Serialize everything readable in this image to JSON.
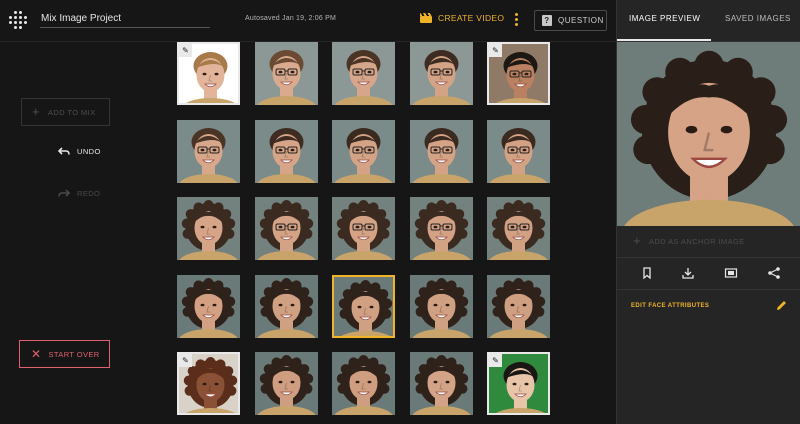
{
  "header": {
    "project_title": "Mix Image Project",
    "autosave": "Autosaved Jan 19, 2:06 PM",
    "create_video": "CREATE VIDEO",
    "question": "QUESTION"
  },
  "left": {
    "add_to_mix": "ADD TO MIX",
    "undo": "UNDO",
    "redo": "REDO",
    "start_over": "START OVER"
  },
  "right_panel": {
    "tab_preview": "IMAGE PREVIEW",
    "tab_saved": "SAVED IMAGES",
    "add_anchor": "ADD AS ANCHOR IMAGE",
    "edit_face_attributes": "EDIT FACE ATTRIBUTES"
  },
  "colors": {
    "accent": "#f0b429",
    "danger": "#e0626e",
    "background": "#161616",
    "panel": "#252525"
  },
  "icons": {
    "logo": "dotted-grid-logo",
    "create_video": "clapperboard-icon",
    "more": "kebab-menu-icon",
    "question": "question-mark-icon",
    "undo": "undo-arrow-icon",
    "redo": "redo-arrow-icon",
    "start_over": "close-x-icon",
    "bookmark": "bookmark-icon",
    "download": "download-icon",
    "slideshow": "slideshow-icon",
    "share": "share-icon",
    "edit": "pencil-icon"
  },
  "grid": {
    "rows": 5,
    "columns": 5,
    "anchors": [
      0,
      4,
      20,
      24
    ],
    "selected": 17,
    "tiles": [
      {
        "skin": "#e2b59a",
        "hair": "#a87a4a",
        "bg": "#ffffff",
        "glasses": false,
        "smile": true,
        "curly": false
      },
      {
        "skin": "#d9aa8d",
        "hair": "#6b4a34",
        "bg": "#8c9896",
        "glasses": true,
        "smile": true,
        "curly": false
      },
      {
        "skin": "#d6a68a",
        "hair": "#4a3426",
        "bg": "#8c9896",
        "glasses": true,
        "smile": true,
        "curly": false
      },
      {
        "skin": "#d4a386",
        "hair": "#3e2c22",
        "bg": "#8c9896",
        "glasses": true,
        "smile": true,
        "curly": false
      },
      {
        "skin": "#b98061",
        "hair": "#1e1814",
        "bg": "#8e7a66",
        "glasses": true,
        "smile": true,
        "curly": false
      },
      {
        "skin": "#d8a78a",
        "hair": "#4a3426",
        "bg": "#7b8b89",
        "glasses": true,
        "smile": true,
        "curly": false
      },
      {
        "skin": "#d6a588",
        "hair": "#3e2c22",
        "bg": "#7b8b89",
        "glasses": true,
        "smile": true,
        "curly": false
      },
      {
        "skin": "#d4a386",
        "hair": "#3a2a20",
        "bg": "#7b8b89",
        "glasses": true,
        "smile": true,
        "curly": false
      },
      {
        "skin": "#d4a386",
        "hair": "#3a2a20",
        "bg": "#7b8b89",
        "glasses": true,
        "smile": true,
        "curly": false
      },
      {
        "skin": "#d3a285",
        "hair": "#3a2a20",
        "bg": "#7b8b89",
        "glasses": true,
        "smile": true,
        "curly": false
      },
      {
        "skin": "#d6a588",
        "hair": "#3a2a20",
        "bg": "#73827f",
        "glasses": false,
        "smile": true,
        "curly": true
      },
      {
        "skin": "#d4a386",
        "hair": "#3a2a20",
        "bg": "#73827f",
        "glasses": true,
        "smile": true,
        "curly": true
      },
      {
        "skin": "#d4a386",
        "hair": "#3a2a20",
        "bg": "#73827f",
        "glasses": true,
        "smile": true,
        "curly": true
      },
      {
        "skin": "#d3a285",
        "hair": "#3a2a20",
        "bg": "#73827f",
        "glasses": true,
        "smile": true,
        "curly": true
      },
      {
        "skin": "#d2a184",
        "hair": "#3a2a20",
        "bg": "#73827f",
        "glasses": true,
        "smile": true,
        "curly": true
      },
      {
        "skin": "#d3a084",
        "hair": "#2e221a",
        "bg": "#6a7a78",
        "glasses": false,
        "smile": true,
        "curly": true
      },
      {
        "skin": "#d0a083",
        "hair": "#2e221a",
        "bg": "#6a7a78",
        "glasses": false,
        "smile": true,
        "curly": true
      },
      {
        "skin": "#d0a083",
        "hair": "#2e221a",
        "bg": "#6a7a78",
        "glasses": false,
        "smile": true,
        "curly": true
      },
      {
        "skin": "#d0a083",
        "hair": "#2e221a",
        "bg": "#6a7a78",
        "glasses": false,
        "smile": true,
        "curly": true
      },
      {
        "skin": "#cf9f82",
        "hair": "#2e221a",
        "bg": "#6a7a78",
        "glasses": false,
        "smile": true,
        "curly": true
      },
      {
        "skin": "#8a5136",
        "hair": "#5a2e1a",
        "bg": "#d8d2c8",
        "glasses": false,
        "smile": true,
        "curly": true
      },
      {
        "skin": "#cf9e81",
        "hair": "#2e221a",
        "bg": "#6a7a78",
        "glasses": false,
        "smile": true,
        "curly": true
      },
      {
        "skin": "#cf9e81",
        "hair": "#2e221a",
        "bg": "#6a7a78",
        "glasses": false,
        "smile": true,
        "curly": true
      },
      {
        "skin": "#d2a387",
        "hair": "#2e221a",
        "bg": "#6a7a78",
        "glasses": false,
        "smile": true,
        "curly": true
      },
      {
        "skin": "#e8c4a8",
        "hair": "#1a1614",
        "bg": "#2f8a3e",
        "glasses": false,
        "smile": true,
        "curly": false
      }
    ]
  },
  "preview": {
    "skin": "#d6a386",
    "hair": "#2a1f18",
    "bg": "#6f7d7a",
    "glasses": false,
    "smile": true,
    "curly": true
  }
}
